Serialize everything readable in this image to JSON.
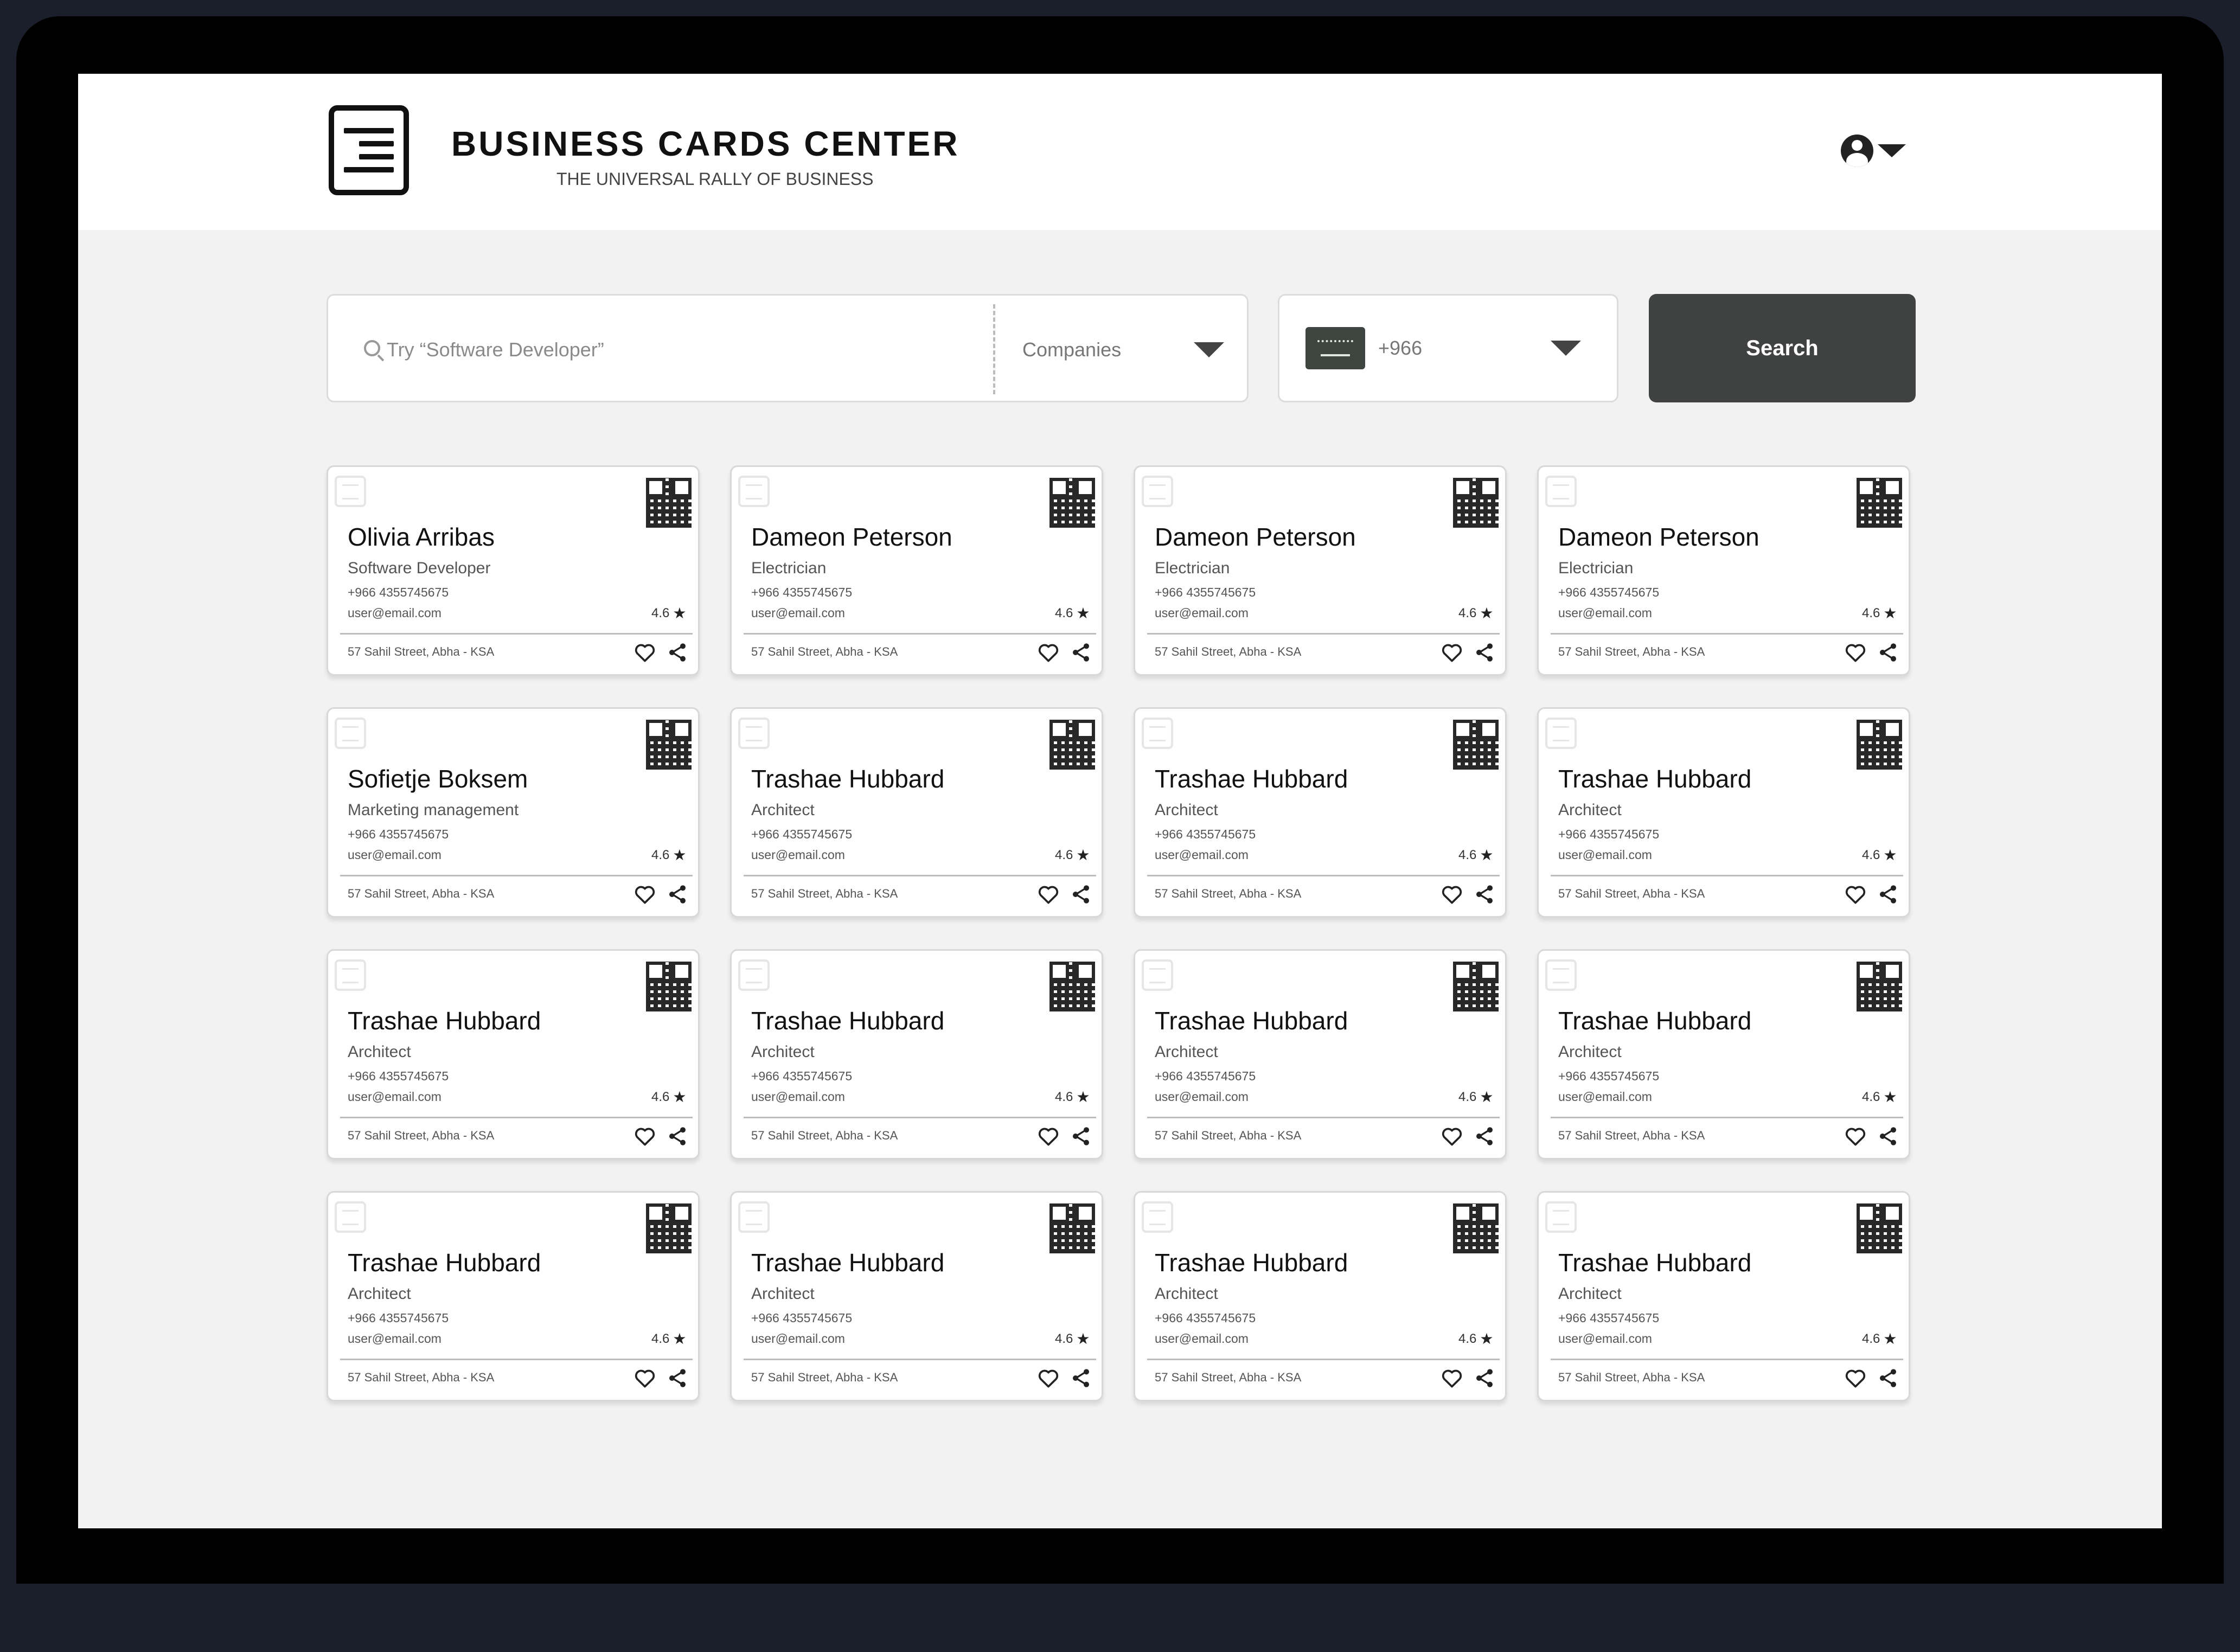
{
  "header": {
    "brand_title": "BUSINESS CARDS CENTER",
    "brand_subtitle": "THE UNIVERSAL RALLY OF BUSINESS"
  },
  "search": {
    "placeholder": "Try “Software Developer”",
    "category": "Companies",
    "country_code": "+966",
    "button_label": "Search"
  },
  "cards": [
    {
      "name": "Olivia Arribas",
      "title": "Software Developer",
      "phone": "+966 4355745675",
      "email": "user@email.com",
      "rating": "4.6",
      "address": "57 Sahil Street, Abha  - KSA"
    },
    {
      "name": "Dameon Peterson",
      "title": "Electrician",
      "phone": "+966 4355745675",
      "email": "user@email.com",
      "rating": "4.6",
      "address": "57 Sahil Street, Abha  - KSA"
    },
    {
      "name": "Dameon Peterson",
      "title": "Electrician",
      "phone": "+966 4355745675",
      "email": "user@email.com",
      "rating": "4.6",
      "address": "57 Sahil Street, Abha  - KSA"
    },
    {
      "name": "Dameon Peterson",
      "title": "Electrician",
      "phone": "+966 4355745675",
      "email": "user@email.com",
      "rating": "4.6",
      "address": "57 Sahil Street, Abha  - KSA"
    },
    {
      "name": "Sofietje Boksem",
      "title": "Marketing management",
      "phone": "+966 4355745675",
      "email": "user@email.com",
      "rating": "4.6",
      "address": "57 Sahil Street, Abha  - KSA"
    },
    {
      "name": "Trashae Hubbard",
      "title": "Architect",
      "phone": "+966 4355745675",
      "email": "user@email.com",
      "rating": "4.6",
      "address": "57 Sahil Street, Abha  - KSA"
    },
    {
      "name": "Trashae Hubbard",
      "title": "Architect",
      "phone": "+966 4355745675",
      "email": "user@email.com",
      "rating": "4.6",
      "address": "57 Sahil Street, Abha  - KSA"
    },
    {
      "name": "Trashae Hubbard",
      "title": "Architect",
      "phone": "+966 4355745675",
      "email": "user@email.com",
      "rating": "4.6",
      "address": "57 Sahil Street, Abha  - KSA"
    },
    {
      "name": "Trashae Hubbard",
      "title": "Architect",
      "phone": "+966 4355745675",
      "email": "user@email.com",
      "rating": "4.6",
      "address": "57 Sahil Street, Abha  - KSA"
    },
    {
      "name": "Trashae Hubbard",
      "title": "Architect",
      "phone": "+966 4355745675",
      "email": "user@email.com",
      "rating": "4.6",
      "address": "57 Sahil Street, Abha  - KSA"
    },
    {
      "name": "Trashae Hubbard",
      "title": "Architect",
      "phone": "+966 4355745675",
      "email": "user@email.com",
      "rating": "4.6",
      "address": "57 Sahil Street, Abha  - KSA"
    },
    {
      "name": "Trashae Hubbard",
      "title": "Architect",
      "phone": "+966 4355745675",
      "email": "user@email.com",
      "rating": "4.6",
      "address": "57 Sahil Street, Abha  - KSA"
    },
    {
      "name": "Trashae Hubbard",
      "title": "Architect",
      "phone": "+966 4355745675",
      "email": "user@email.com",
      "rating": "4.6",
      "address": "57 Sahil Street, Abha  - KSA"
    },
    {
      "name": "Trashae Hubbard",
      "title": "Architect",
      "phone": "+966 4355745675",
      "email": "user@email.com",
      "rating": "4.6",
      "address": "57 Sahil Street, Abha  - KSA"
    },
    {
      "name": "Trashae Hubbard",
      "title": "Architect",
      "phone": "+966 4355745675",
      "email": "user@email.com",
      "rating": "4.6",
      "address": "57 Sahil Street, Abha  - KSA"
    },
    {
      "name": "Trashae Hubbard",
      "title": "Architect",
      "phone": "+966 4355745675",
      "email": "user@email.com",
      "rating": "4.6",
      "address": "57 Sahil Street, Abha  - KSA"
    }
  ],
  "icons": {
    "brand": "logo-icon",
    "user": "user-icon",
    "search": "search-icon",
    "flag": "saudi-flag-icon",
    "qr": "qr-code-icon",
    "favorite": "heart-icon",
    "share": "share-icon",
    "rating": "star-icon"
  },
  "colors": {
    "page_background": "#f2f2f2",
    "header_background": "#ffffff",
    "button_background": "#3f4240",
    "text_primary": "#111111",
    "device_frame": "#1a1f2b"
  }
}
